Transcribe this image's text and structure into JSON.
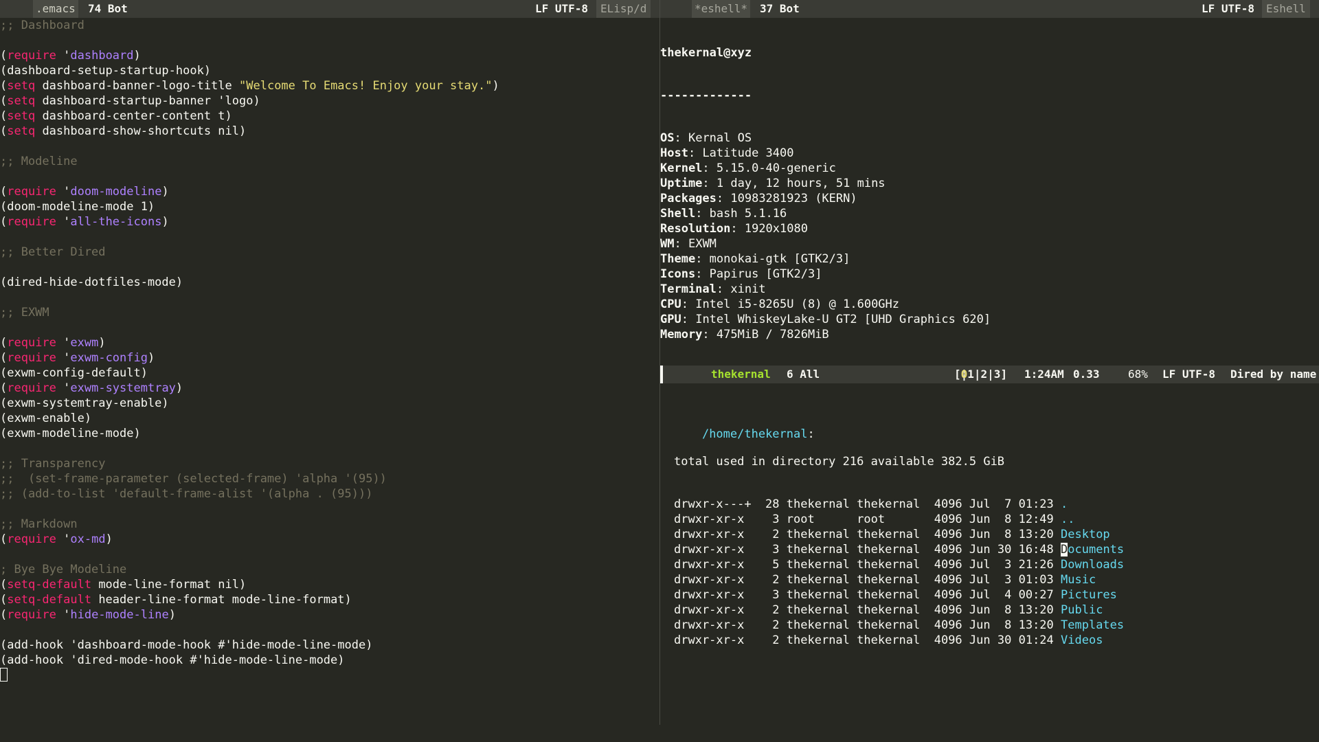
{
  "left_modeline": {
    "icon": "gear-icon",
    "buffer": ".emacs",
    "position": "74 Bot",
    "encoding": "LF UTF-8",
    "mode": "ELisp/d"
  },
  "editor": {
    "lines": [
      [
        {
          "t": ";; Dashboard",
          "c": "com"
        }
      ],
      [],
      [
        {
          "t": "("
        },
        {
          "t": "require",
          "c": "kw"
        },
        {
          "t": " '"
        },
        {
          "t": "dashboard",
          "c": "sym"
        },
        {
          "t": ")"
        }
      ],
      [
        {
          "t": "(dashboard-setup-startup-hook)"
        }
      ],
      [
        {
          "t": "("
        },
        {
          "t": "setq",
          "c": "kw"
        },
        {
          "t": " dashboard-banner-logo-title "
        },
        {
          "t": "\"Welcome To Emacs! Enjoy your stay.\"",
          "c": "str"
        },
        {
          "t": ")"
        }
      ],
      [
        {
          "t": "("
        },
        {
          "t": "setq",
          "c": "kw"
        },
        {
          "t": " dashboard-startup-banner 'logo)"
        }
      ],
      [
        {
          "t": "("
        },
        {
          "t": "setq",
          "c": "kw"
        },
        {
          "t": " dashboard-center-content t)"
        }
      ],
      [
        {
          "t": "("
        },
        {
          "t": "setq",
          "c": "kw"
        },
        {
          "t": " dashboard-show-shortcuts nil)"
        }
      ],
      [],
      [
        {
          "t": ";; Modeline",
          "c": "com"
        }
      ],
      [],
      [
        {
          "t": "("
        },
        {
          "t": "require",
          "c": "kw"
        },
        {
          "t": " '"
        },
        {
          "t": "doom-modeline",
          "c": "sym"
        },
        {
          "t": ")"
        }
      ],
      [
        {
          "t": "(doom-modeline-mode 1)"
        }
      ],
      [
        {
          "t": "("
        },
        {
          "t": "require",
          "c": "kw"
        },
        {
          "t": " '"
        },
        {
          "t": "all-the-icons",
          "c": "sym"
        },
        {
          "t": ")"
        }
      ],
      [],
      [
        {
          "t": ";; Better Dired",
          "c": "com"
        }
      ],
      [],
      [
        {
          "t": "(dired-hide-dotfiles-mode)"
        }
      ],
      [],
      [
        {
          "t": ";; EXWM",
          "c": "com"
        }
      ],
      [],
      [
        {
          "t": "("
        },
        {
          "t": "require",
          "c": "kw"
        },
        {
          "t": " '"
        },
        {
          "t": "exwm",
          "c": "sym"
        },
        {
          "t": ")"
        }
      ],
      [
        {
          "t": "("
        },
        {
          "t": "require",
          "c": "kw"
        },
        {
          "t": " '"
        },
        {
          "t": "exwm-config",
          "c": "sym"
        },
        {
          "t": ")"
        }
      ],
      [
        {
          "t": "(exwm-config-default)"
        }
      ],
      [
        {
          "t": "("
        },
        {
          "t": "require",
          "c": "kw"
        },
        {
          "t": " '"
        },
        {
          "t": "exwm-systemtray",
          "c": "sym"
        },
        {
          "t": ")"
        }
      ],
      [
        {
          "t": "(exwm-systemtray-enable)"
        }
      ],
      [
        {
          "t": "(exwm-enable)"
        }
      ],
      [
        {
          "t": "(exwm-modeline-mode)"
        }
      ],
      [],
      [
        {
          "t": ";; Transparency",
          "c": "com"
        }
      ],
      [
        {
          "t": ";;  (set-frame-parameter (selected-frame) 'alpha '(95))",
          "c": "com"
        }
      ],
      [
        {
          "t": ";; (add-to-list 'default-frame-alist '(alpha . (95)))",
          "c": "com"
        }
      ],
      [],
      [
        {
          "t": ";; Markdown",
          "c": "com"
        }
      ],
      [
        {
          "t": "("
        },
        {
          "t": "require",
          "c": "kw"
        },
        {
          "t": " '"
        },
        {
          "t": "ox-md",
          "c": "sym"
        },
        {
          "t": ")"
        }
      ],
      [],
      [
        {
          "t": "; Bye Bye Modeline",
          "c": "com"
        }
      ],
      [
        {
          "t": "("
        },
        {
          "t": "setq-default",
          "c": "kw"
        },
        {
          "t": " mode-line-format nil)"
        }
      ],
      [
        {
          "t": "("
        },
        {
          "t": "setq-default",
          "c": "kw"
        },
        {
          "t": " header-line-format mode-line-format)"
        }
      ],
      [
        {
          "t": "("
        },
        {
          "t": "require",
          "c": "kw"
        },
        {
          "t": " '"
        },
        {
          "t": "hide-mode-line",
          "c": "sym"
        },
        {
          "t": ")"
        }
      ],
      [],
      [
        {
          "t": "(add-hook 'dashboard-mode-hook #'hide-mode-line-mode)"
        }
      ],
      [
        {
          "t": "(add-hook 'dired-mode-hook #'hide-mode-line-mode)"
        }
      ]
    ]
  },
  "right_modeline": {
    "icon": "terminal-icon",
    "buffer": "*eshell*",
    "position": "37 Bot",
    "encoding": "LF UTF-8",
    "mode": "Eshell"
  },
  "eshell": {
    "header": "thekernal@xyz",
    "separator": "-------------",
    "info": [
      {
        "k": "OS",
        "v": "Kernal OS"
      },
      {
        "k": "Host",
        "v": "Latitude 3400"
      },
      {
        "k": "Kernel",
        "v": "5.15.0-40-generic"
      },
      {
        "k": "Uptime",
        "v": "1 day, 12 hours, 51 mins"
      },
      {
        "k": "Packages",
        "v": "10983281923 (KERN)"
      },
      {
        "k": "Shell",
        "v": "bash 5.1.16"
      },
      {
        "k": "Resolution",
        "v": "1920x1080"
      },
      {
        "k": "WM",
        "v": "EXWM"
      },
      {
        "k": "Theme",
        "v": "monokai-gtk [GTK2/3]"
      },
      {
        "k": "Icons",
        "v": "Papirus [GTK2/3]"
      },
      {
        "k": "Terminal",
        "v": "xinit"
      },
      {
        "k": "CPU",
        "v": "Intel i5-8265U (8) @ 1.600GHz"
      },
      {
        "k": "GPU",
        "v": "Intel WhiskeyLake-U GT2 [UHD Graphics 620]"
      },
      {
        "k": "Memory",
        "v": "475MiB / 7826MiB"
      }
    ],
    "palette": [
      "#000000",
      "#cc0000",
      "#00cc00",
      "#cccc00",
      "#0000ee",
      "#cc00cc",
      "#00cccc",
      "#e5e5e5"
    ],
    "prompt_dir": "~",
    "prompt_symbol": "$"
  },
  "dired_modeline": {
    "folder_icon": "folder-icon",
    "lock_icon": "lock-icon",
    "user": "thekernal",
    "position": "6 All",
    "workspaces": "[0|1|2|3]",
    "time": "1:24AM",
    "load": "0.33",
    "battery_icon": "battery-icon",
    "battery": "68%",
    "encoding": "LF UTF-8",
    "mode": "Dired by name"
  },
  "dired": {
    "path": "/home/thekernal",
    "path_suffix": ":",
    "summary": "total used in directory 216 available 382.5 GiB",
    "rows": [
      {
        "perm": "drwxr-x---+",
        "links": "28",
        "owner": "thekernal",
        "group": "thekernal",
        "size": "4096",
        "month": "Jul",
        "day": "7",
        "time": "01:23",
        "name": "."
      },
      {
        "perm": "drwxr-xr-x",
        "links": "3",
        "owner": "root",
        "group": "root",
        "size": "4096",
        "month": "Jun",
        "day": "8",
        "time": "12:49",
        "name": ".."
      },
      {
        "perm": "drwxr-xr-x",
        "links": "2",
        "owner": "thekernal",
        "group": "thekernal",
        "size": "4096",
        "month": "Jun",
        "day": "8",
        "time": "13:20",
        "name": "Desktop"
      },
      {
        "perm": "drwxr-xr-x",
        "links": "3",
        "owner": "thekernal",
        "group": "thekernal",
        "size": "4096",
        "month": "Jun",
        "day": "30",
        "time": "16:48",
        "name": "Documents"
      },
      {
        "perm": "drwxr-xr-x",
        "links": "5",
        "owner": "thekernal",
        "group": "thekernal",
        "size": "4096",
        "month": "Jul",
        "day": "3",
        "time": "21:26",
        "name": "Downloads"
      },
      {
        "perm": "drwxr-xr-x",
        "links": "2",
        "owner": "thekernal",
        "group": "thekernal",
        "size": "4096",
        "month": "Jul",
        "day": "3",
        "time": "01:03",
        "name": "Music"
      },
      {
        "perm": "drwxr-xr-x",
        "links": "3",
        "owner": "thekernal",
        "group": "thekernal",
        "size": "4096",
        "month": "Jul",
        "day": "4",
        "time": "00:27",
        "name": "Pictures"
      },
      {
        "perm": "drwxr-xr-x",
        "links": "2",
        "owner": "thekernal",
        "group": "thekernal",
        "size": "4096",
        "month": "Jun",
        "day": "8",
        "time": "13:20",
        "name": "Public"
      },
      {
        "perm": "drwxr-xr-x",
        "links": "2",
        "owner": "thekernal",
        "group": "thekernal",
        "size": "4096",
        "month": "Jun",
        "day": "8",
        "time": "13:20",
        "name": "Templates"
      },
      {
        "perm": "drwxr-xr-x",
        "links": "2",
        "owner": "thekernal",
        "group": "thekernal",
        "size": "4096",
        "month": "Jun",
        "day": "30",
        "time": "01:24",
        "name": "Videos"
      }
    ],
    "cursor_row": 3
  },
  "colors": {
    "background": "#272822",
    "foreground": "#f8f8f2",
    "comment": "#75715e",
    "keyword": "#f92672",
    "symbol": "#ae81ff",
    "string": "#e6db74",
    "directory": "#66d9ef",
    "user": "#a6e22e",
    "modeline": "#3a3b35"
  }
}
